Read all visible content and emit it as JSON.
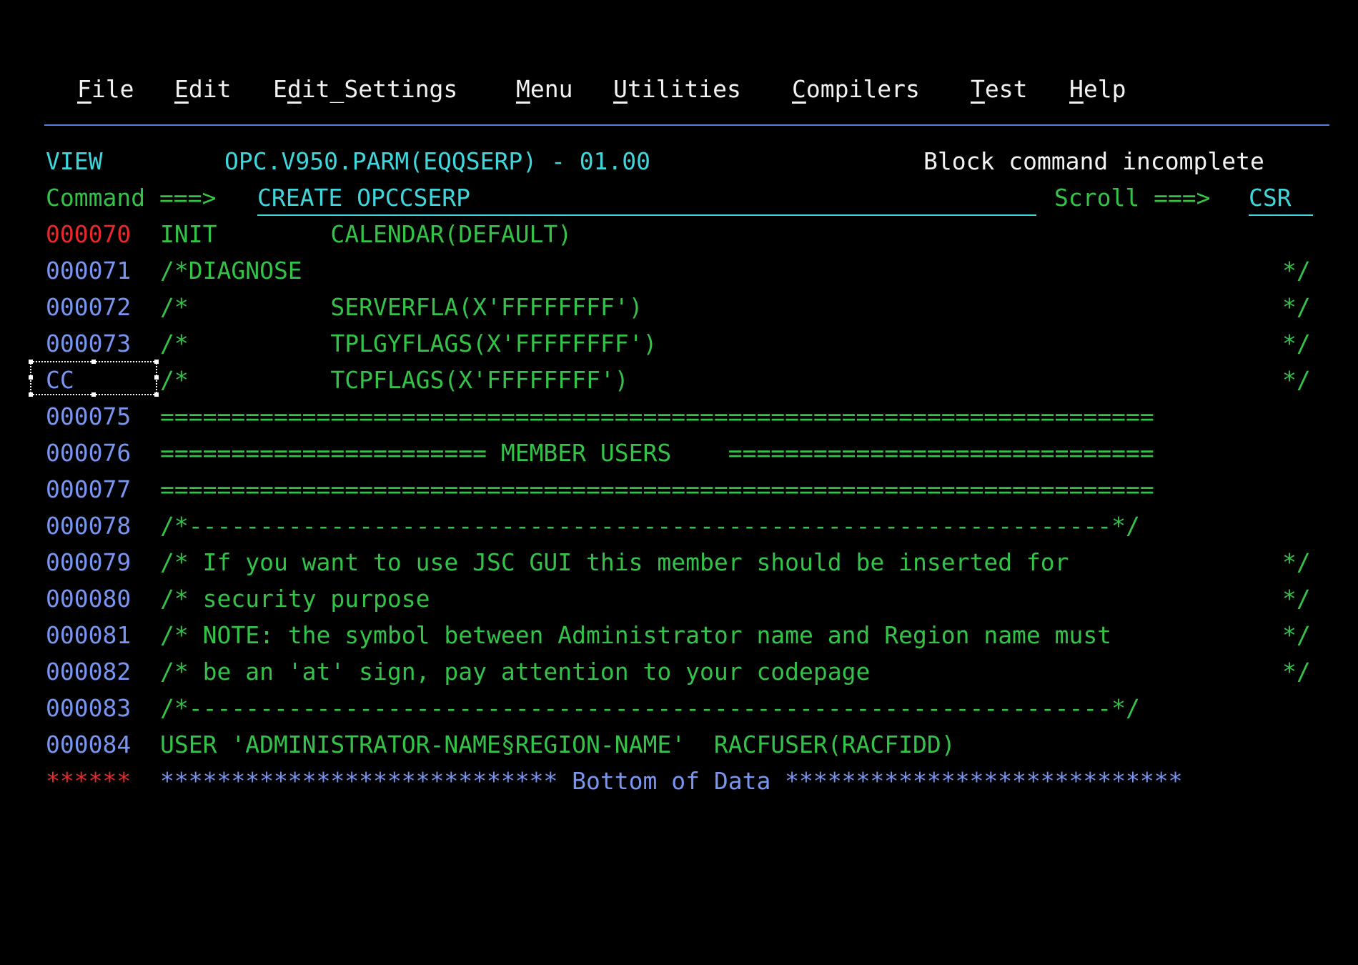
{
  "menu": {
    "items": [
      {
        "pre": "",
        "acc": "F",
        "post": "ile"
      },
      {
        "pre": "",
        "acc": "E",
        "post": "dit"
      },
      {
        "pre": "E",
        "acc": "d",
        "post": "it_Settings"
      },
      {
        "pre": "",
        "acc": "M",
        "post": "enu"
      },
      {
        "pre": "",
        "acc": "U",
        "post": "tilities"
      },
      {
        "pre": "",
        "acc": "C",
        "post": "ompilers"
      },
      {
        "pre": "",
        "acc": "T",
        "post": "est"
      },
      {
        "pre": "",
        "acc": "H",
        "post": "elp"
      }
    ]
  },
  "header": {
    "mode": "VIEW",
    "dataset": "OPC.V950.PARM(EQQSERP) - 01.00",
    "message": "Block command incomplete"
  },
  "command": {
    "label": "Command ===>",
    "value": "CREATE OPCCSERP",
    "scroll_label": "Scroll ===>",
    "scroll_value": "CSR"
  },
  "lines": [
    {
      "num": "000070",
      "text": "INIT        CALENDAR(DEFAULT)",
      "end": ""
    },
    {
      "num": "000071",
      "text": "/*DIAGNOSE",
      "end": "*/"
    },
    {
      "num": "000072",
      "text": "/*          SERVERFLA(X'FFFFFFFF')",
      "end": "*/"
    },
    {
      "num": "000073",
      "text": "/*          TPLGYFLAGS(X'FFFFFFFF')",
      "end": "*/"
    },
    {
      "num": "CC",
      "text": "/*          TCPFLAGS(X'FFFFFFFF')",
      "end": "*/"
    },
    {
      "num": "000075",
      "text": "======================================================================",
      "end": ""
    },
    {
      "num": "000076",
      "text": "======================= MEMBER USERS    ==============================",
      "end": ""
    },
    {
      "num": "000077",
      "text": "======================================================================",
      "end": ""
    },
    {
      "num": "000078",
      "text": "/*-----------------------------------------------------------------*/",
      "end": ""
    },
    {
      "num": "000079",
      "text": "/* If you want to use JSC GUI this member should be inserted for",
      "end": "*/"
    },
    {
      "num": "000080",
      "text": "/* security purpose",
      "end": "*/"
    },
    {
      "num": "000081",
      "text": "/* NOTE: the symbol between Administrator name and Region name must",
      "end": "*/"
    },
    {
      "num": "000082",
      "text": "/* be an 'at' sign, pay attention to your codepage",
      "end": "*/"
    },
    {
      "num": "000083",
      "text": "/*-----------------------------------------------------------------*/",
      "end": ""
    },
    {
      "num": "000084",
      "text": "USER 'ADMINISTRATOR-NAME§REGION-NAME'  RACFUSER(RACFIDD)",
      "end": ""
    }
  ],
  "bottom": {
    "marker": "******",
    "text": "**************************** Bottom of Data ****************************"
  },
  "colors": {
    "background": "#000000",
    "data_text": "#34c248",
    "line_numbers": "#7a95f0",
    "header_text": "#3fd6dc",
    "menu_text": "#f2f2f2",
    "current_line_number": "#e8282c"
  }
}
